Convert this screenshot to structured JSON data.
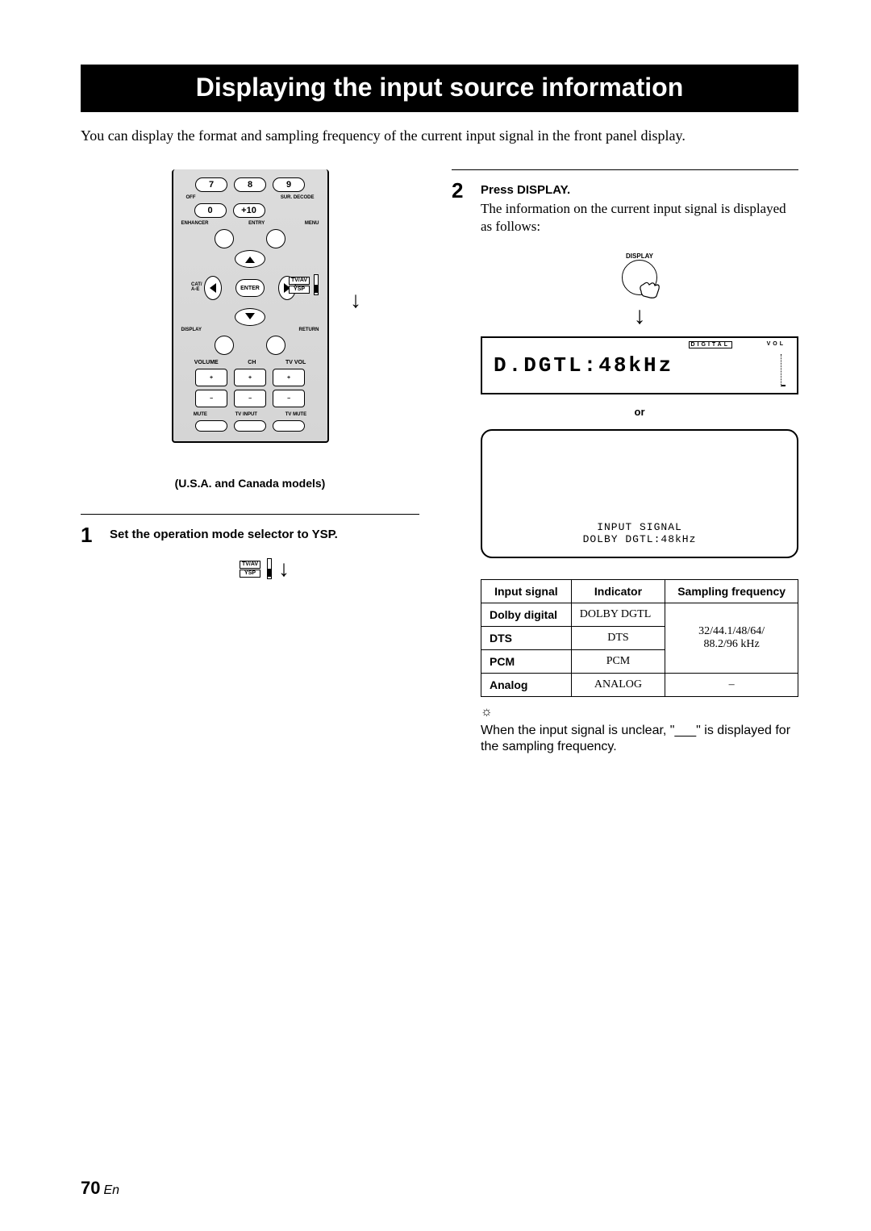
{
  "title": "Displaying the input source information",
  "intro": "You can display the format and sampling frequency of the current input signal in the front panel display.",
  "remote": {
    "keys_row1": [
      "7",
      "8",
      "9"
    ],
    "keys_row2": [
      "0",
      "+10"
    ],
    "labels": {
      "off": "OFF",
      "sur_decode": "SUR. DECODE",
      "enhancer": "ENHANCER",
      "entry": "ENTRY",
      "menu": "MENU",
      "cat": "CAT/\nA-E",
      "enter": "ENTER",
      "tvav": "TV/AV",
      "ysp": "YSP",
      "display": "DISPLAY",
      "return": "RETURN",
      "volume": "VOLUME",
      "ch": "CH",
      "tvvol": "TV VOL",
      "mute": "MUTE",
      "tvinput": "TV INPUT",
      "tvmute": "TV MUTE"
    },
    "caption": "(U.S.A. and Canada models)"
  },
  "step1": {
    "num": "1",
    "title": "Set the operation mode selector to YSP.",
    "switch_top": "TV/AV",
    "switch_bottom": "YSP"
  },
  "step2": {
    "num": "2",
    "title": "Press DISPLAY.",
    "desc": "The information on the current input signal is displayed as follows:",
    "display_label": "DISPLAY",
    "lcd_text": "D.DGTL:48kHz",
    "lcd_digital": "DIGITAL",
    "lcd_vol": "VOL",
    "or": "or",
    "osd_line1": "INPUT SIGNAL",
    "osd_line2": "DOLBY DGTL:48kHz"
  },
  "table": {
    "headers": [
      "Input signal",
      "Indicator",
      "Sampling frequency"
    ],
    "rows": [
      {
        "signal": "Dolby digital",
        "indicator": "DOLBY DGTL"
      },
      {
        "signal": "DTS",
        "indicator": "DTS"
      },
      {
        "signal": "PCM",
        "indicator": "PCM"
      }
    ],
    "shared_freq": "32/44.1/48/64/\n88.2/96 kHz",
    "analog_row": {
      "signal": "Analog",
      "indicator": "ANALOG",
      "freq": "–"
    }
  },
  "tip": "When the input signal is unclear, \"___\" is displayed for the sampling frequency.",
  "page": {
    "num": "70",
    "lang": "En"
  }
}
